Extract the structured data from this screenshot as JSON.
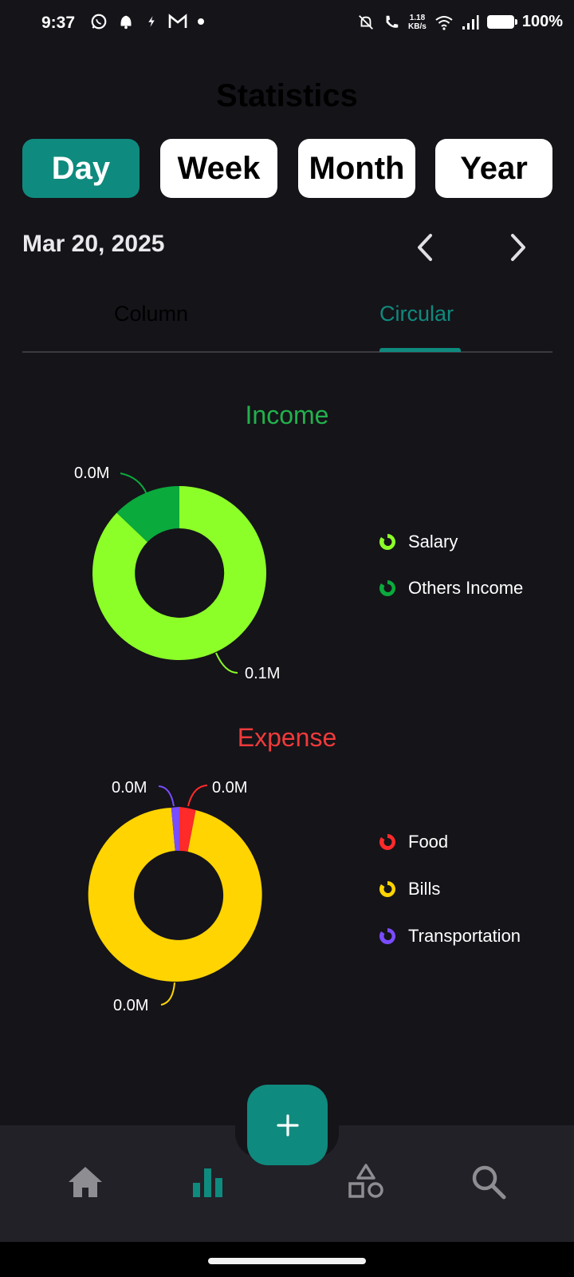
{
  "status_bar": {
    "time": "9:37",
    "net_speed_value": "1.18",
    "net_speed_unit": "KB/s",
    "battery": "100%"
  },
  "header": {
    "title": "Statistics"
  },
  "period_tabs": [
    {
      "label": "Day",
      "active": true
    },
    {
      "label": "Week",
      "active": false
    },
    {
      "label": "Month",
      "active": false
    },
    {
      "label": "Year",
      "active": false
    }
  ],
  "date": "Mar 20, 2025",
  "view_tabs": [
    {
      "label": "Column",
      "active": false
    },
    {
      "label": "Circular",
      "active": true
    }
  ],
  "colors": {
    "accent": "#0f8a7e",
    "income_title": "#22b14c",
    "expense_title": "#f03a3a",
    "salary": "#8cff29",
    "others_income": "#0aaa3c",
    "food": "#ff2a2a",
    "bills": "#ffd400",
    "transportation": "#7a4cff"
  },
  "income": {
    "title": "Income",
    "legend": [
      "Salary",
      "Others Income"
    ],
    "labels": [
      "0.1M",
      "0.0M"
    ]
  },
  "expense": {
    "title": "Expense",
    "legend": [
      "Food",
      "Bills",
      "Transportation"
    ],
    "labels": [
      "0.0M",
      "0.0M",
      "0.0M"
    ]
  },
  "chart_data": [
    {
      "type": "pie",
      "title": "Income",
      "categories": [
        "Salary",
        "Others Income"
      ],
      "values": [
        0.1,
        0.0
      ],
      "slice_fractions": [
        0.885,
        0.115
      ],
      "data_labels": [
        "0.1M",
        "0.0M"
      ]
    },
    {
      "type": "pie",
      "title": "Expense",
      "categories": [
        "Food",
        "Bills",
        "Transportation"
      ],
      "values": [
        0.0,
        0.0,
        0.0
      ],
      "slice_fractions": [
        0.03,
        0.955,
        0.015
      ],
      "data_labels": [
        "0.0M",
        "0.0M",
        "0.0M"
      ]
    }
  ],
  "bottom_nav": {
    "items": [
      "home-icon",
      "stats-icon",
      "categories-icon",
      "search-icon"
    ],
    "fab": "add-icon"
  }
}
